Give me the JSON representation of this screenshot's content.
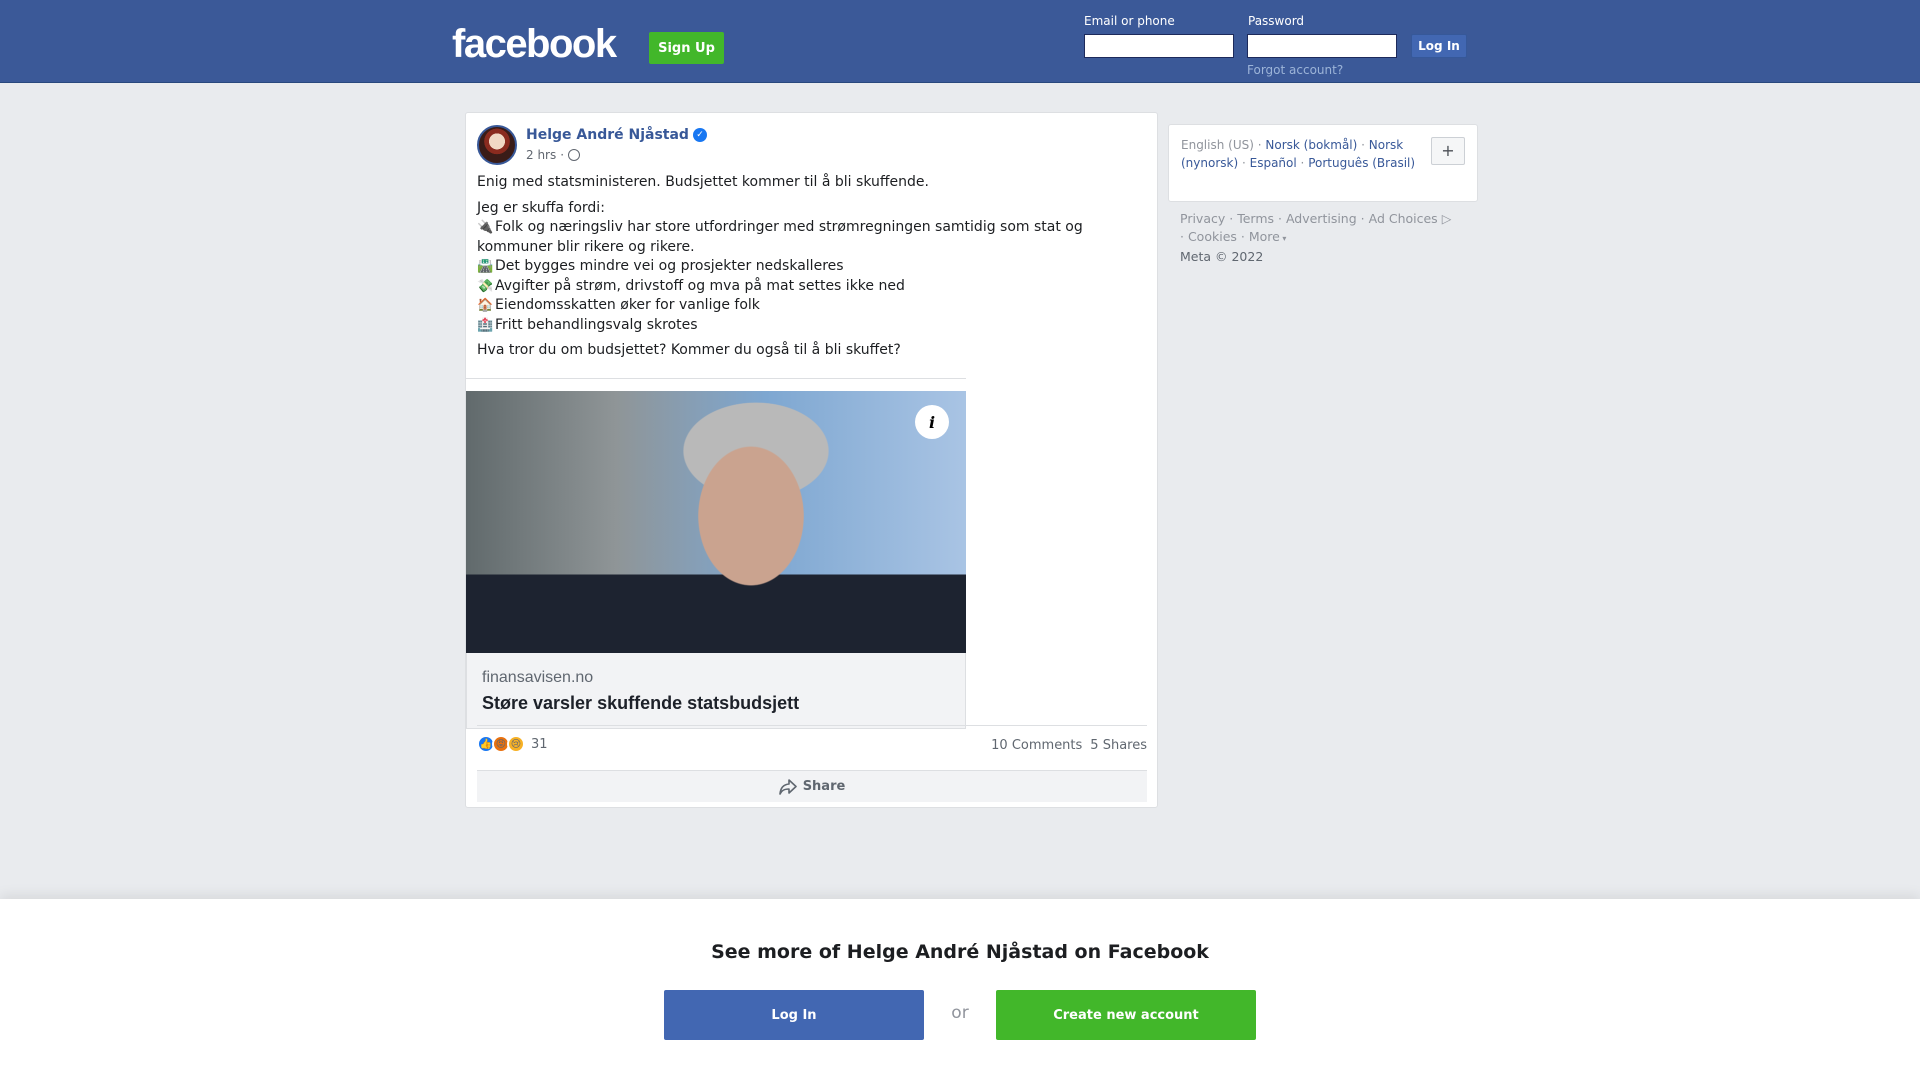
{
  "header": {
    "logo": "facebook",
    "signup_label": "Sign Up",
    "email_label": "Email or phone",
    "password_label": "Password",
    "login_label": "Log In",
    "forgot_label": "Forgot account?"
  },
  "post": {
    "author": "Helge André Njåstad",
    "verified_mark": "✓",
    "time": "2 hrs",
    "meta_sep": "·",
    "intro": "Enig med statsministeren. Budsjettet kommer til å bli skuffende.",
    "heading": "Jeg er skuffa fordi:",
    "points": [
      {
        "emoji": "🔌",
        "text": "Folk og næringsliv har store utfordringer med strømregningen samtidig som stat og kommuner blir rikere og rikere."
      },
      {
        "emoji": "🛣️",
        "text": "Det bygges mindre vei og prosjekter nedskalleres"
      },
      {
        "emoji": "💸",
        "text": "Avgifter på strøm, drivstoff og mva på mat settes ikke ned"
      },
      {
        "emoji": "🏠",
        "text": "Eiendomsskatten øker for vanlige folk"
      },
      {
        "emoji": "🏥",
        "text": "Fritt behandlingsvalg skrotes"
      }
    ],
    "question": "Hva tror du om budsjettet? Kommer du også til å bli skuffet?",
    "link": {
      "info_glyph": "i",
      "domain": "finansavisen.no",
      "title": "Støre varsler skuffende statsbudsjett"
    },
    "reaction_count": "31",
    "comments": "10 Comments",
    "shares": "5 Shares",
    "share_label": "Share"
  },
  "languages": {
    "current": "English (US)",
    "others": [
      "Norsk (bokmål)",
      "Norsk (nynorsk)",
      "Español",
      "Português (Brasil)"
    ],
    "plus": "+"
  },
  "footer": {
    "links": [
      "Privacy",
      "Terms",
      "Advertising",
      "Ad Choices",
      "Cookies",
      "More"
    ],
    "copyright": "Meta © 2022"
  },
  "bottom_sheet": {
    "title": "See more of Helge André Njåstad on Facebook",
    "login_label": "Log In",
    "or_label": "or",
    "create_label": "Create new account"
  }
}
